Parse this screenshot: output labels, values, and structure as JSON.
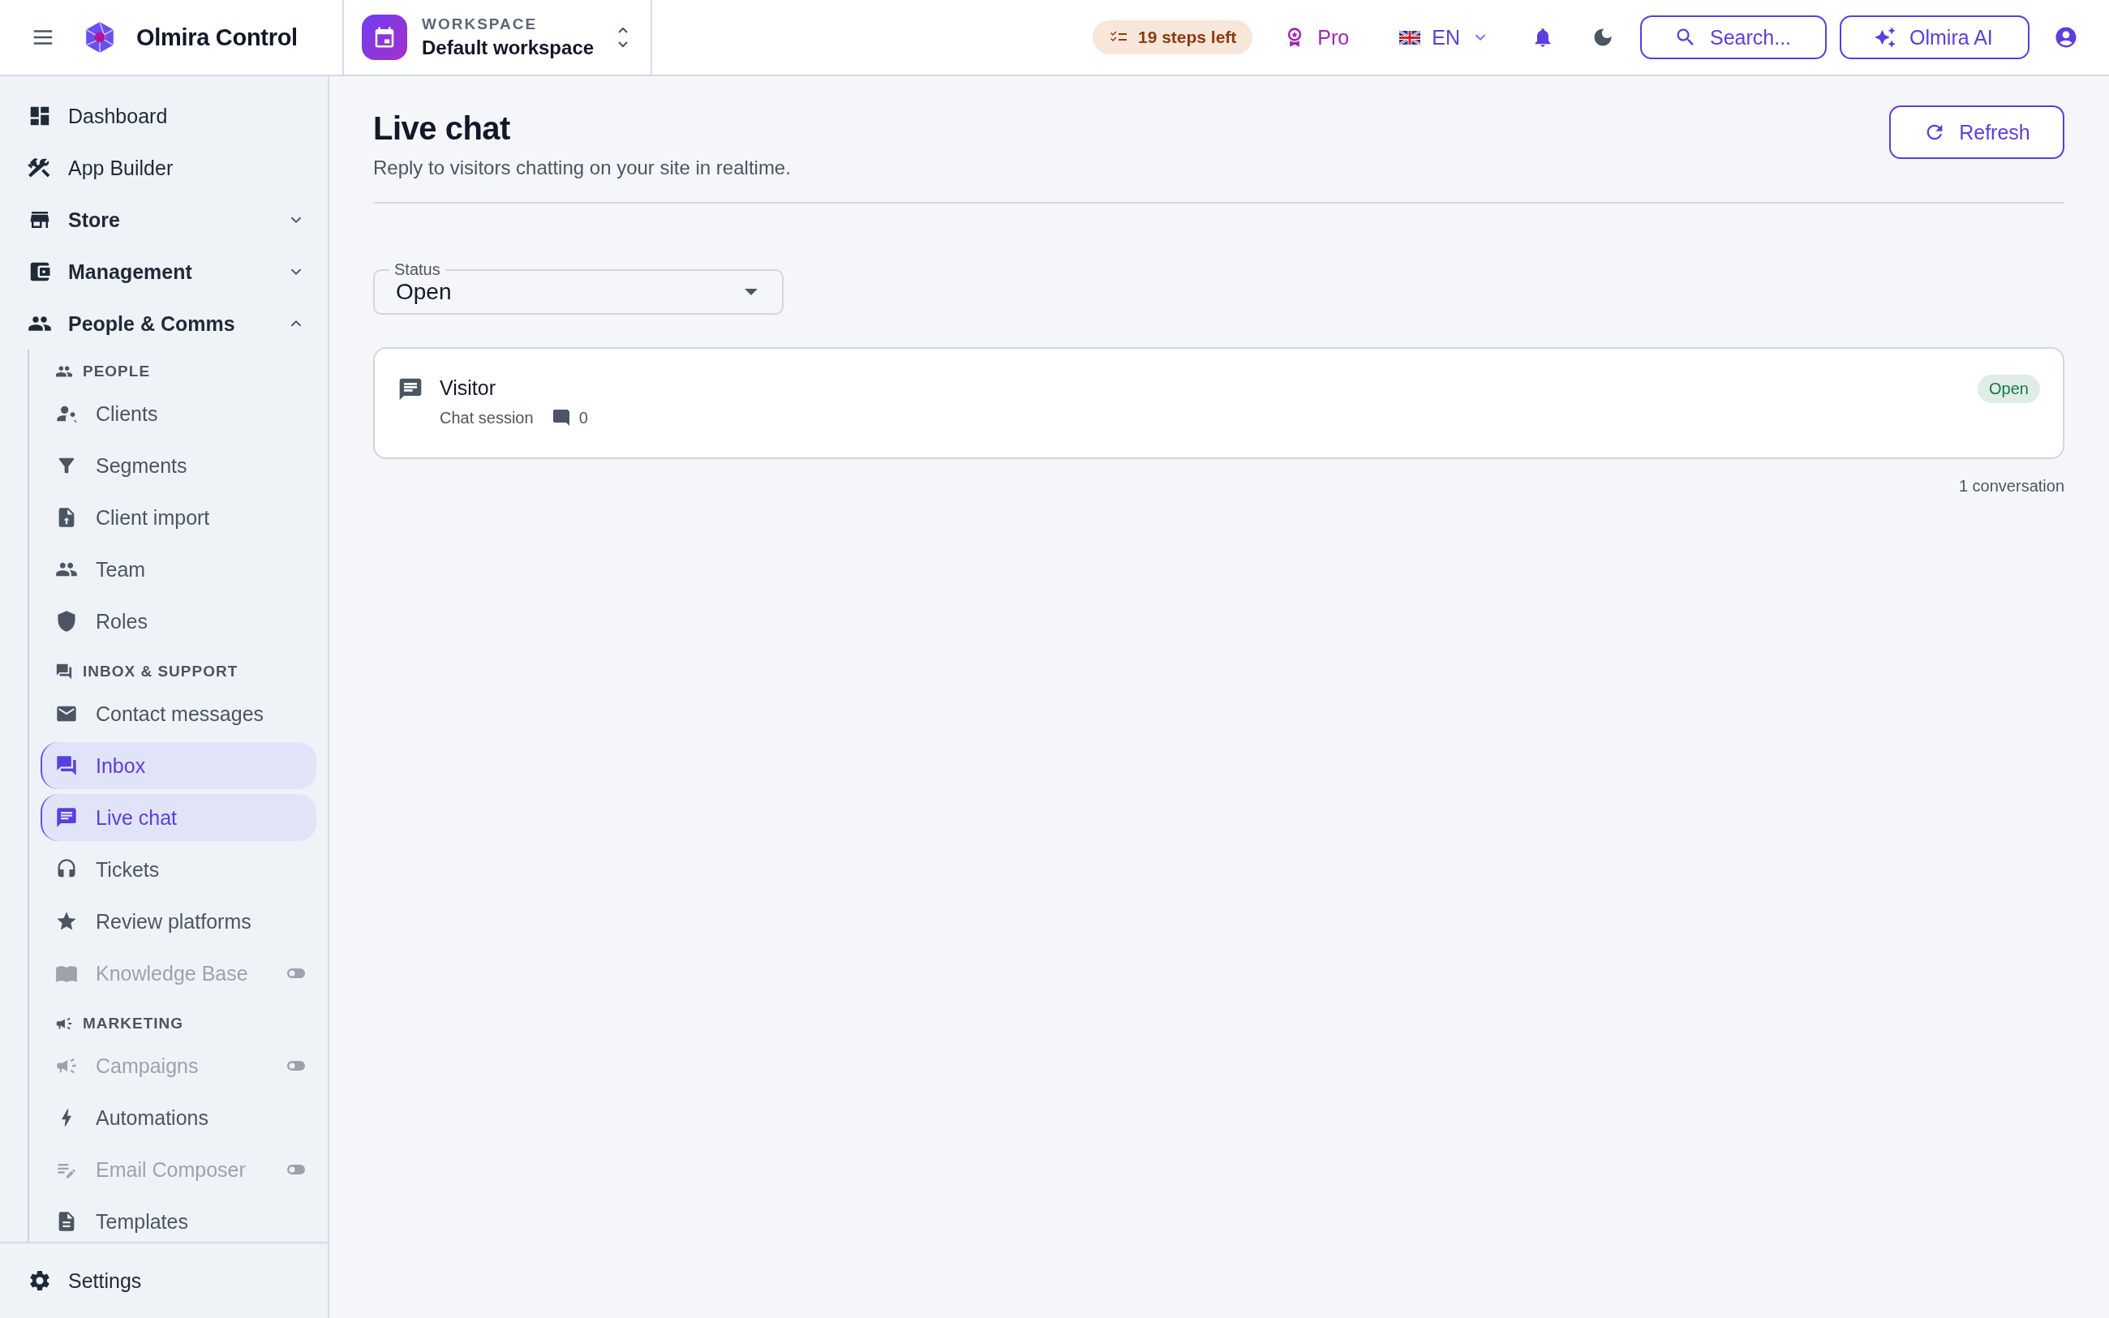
{
  "topbar": {
    "brand": "Olmira Control",
    "workspace": {
      "label": "WORKSPACE",
      "name": "Default workspace"
    },
    "steps_badge": "19 steps left",
    "plan": "Pro",
    "language": "EN",
    "search_button": "Search...",
    "ai_button": "Olmira AI"
  },
  "sidebar": {
    "items": [
      {
        "label": "Dashboard",
        "kind": "link",
        "selected": false,
        "disabled": false
      },
      {
        "label": "App Builder",
        "kind": "link",
        "selected": false,
        "disabled": false
      },
      {
        "label": "Store",
        "kind": "group",
        "expanded": false
      },
      {
        "label": "Management",
        "kind": "group",
        "expanded": false
      },
      {
        "label": "People & Comms",
        "kind": "group",
        "expanded": true,
        "children": [
          {
            "label": "PEOPLE",
            "kind": "section"
          },
          {
            "label": "Clients",
            "kind": "link",
            "selected": false,
            "disabled": false
          },
          {
            "label": "Segments",
            "kind": "link",
            "selected": false,
            "disabled": false
          },
          {
            "label": "Client import",
            "kind": "link",
            "selected": false,
            "disabled": false
          },
          {
            "label": "Team",
            "kind": "link",
            "selected": false,
            "disabled": false
          },
          {
            "label": "Roles",
            "kind": "link",
            "selected": false,
            "disabled": false
          },
          {
            "label": "INBOX & SUPPORT",
            "kind": "section"
          },
          {
            "label": "Contact messages",
            "kind": "link",
            "selected": false,
            "disabled": false
          },
          {
            "label": "Inbox",
            "kind": "link",
            "selected": true,
            "disabled": false
          },
          {
            "label": "Live chat",
            "kind": "link",
            "selected": true,
            "disabled": false
          },
          {
            "label": "Tickets",
            "kind": "link",
            "selected": false,
            "disabled": false
          },
          {
            "label": "Review platforms",
            "kind": "link",
            "selected": false,
            "disabled": false
          },
          {
            "label": "Knowledge Base",
            "kind": "link",
            "selected": false,
            "disabled": true
          },
          {
            "label": "MARKETING",
            "kind": "section"
          },
          {
            "label": "Campaigns",
            "kind": "link",
            "selected": false,
            "disabled": true
          },
          {
            "label": "Automations",
            "kind": "link",
            "selected": false,
            "disabled": false
          },
          {
            "label": "Email Composer",
            "kind": "link",
            "selected": false,
            "disabled": true
          },
          {
            "label": "Templates",
            "kind": "link",
            "selected": false,
            "disabled": false
          }
        ]
      }
    ],
    "footer": {
      "label": "Settings"
    }
  },
  "page": {
    "title": "Live chat",
    "subtitle": "Reply to visitors chatting on your site in realtime.",
    "refresh_button": "Refresh",
    "status_filter": {
      "label": "Status",
      "value": "Open"
    },
    "conversations": [
      {
        "name": "Visitor",
        "type": "Chat session",
        "message_count": "0",
        "status": "Open",
        "color": "#13794a"
      }
    ],
    "count": "1 conversation"
  }
}
